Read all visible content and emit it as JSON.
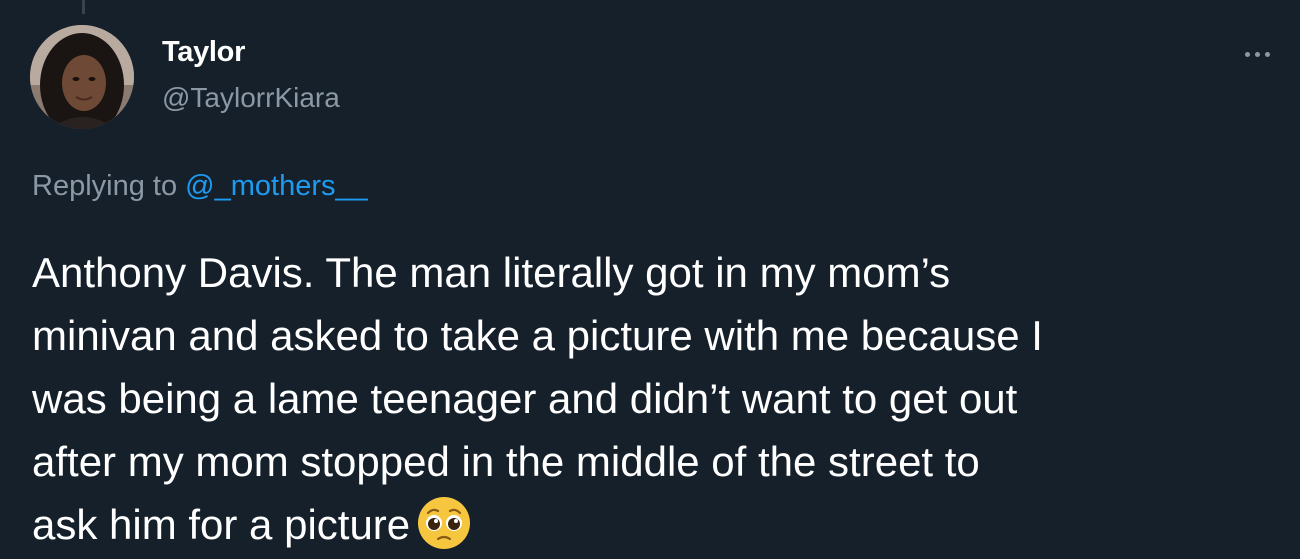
{
  "tweet": {
    "author": {
      "name": "Taylor",
      "handle": "@TaylorrKiara",
      "avatar_icon": "profile-photo"
    },
    "more_icon": "ellipsis-icon",
    "reply_prefix": "Replying to",
    "reply_mention": "@_mothers__",
    "text": "Anthony Davis. The man literally got in my mom’s\nminivan and asked to take a picture with me because I\nwas being a lame teenager and didn’t want to get out\nafter my mom stopped in the middle of the street to\nask him for a picture",
    "emoji": "pleading-face",
    "colors": {
      "background": "#15202b",
      "primary_text": "#ffffff",
      "secondary_text": "#8b98a5",
      "link": "#1d9bf0"
    }
  }
}
